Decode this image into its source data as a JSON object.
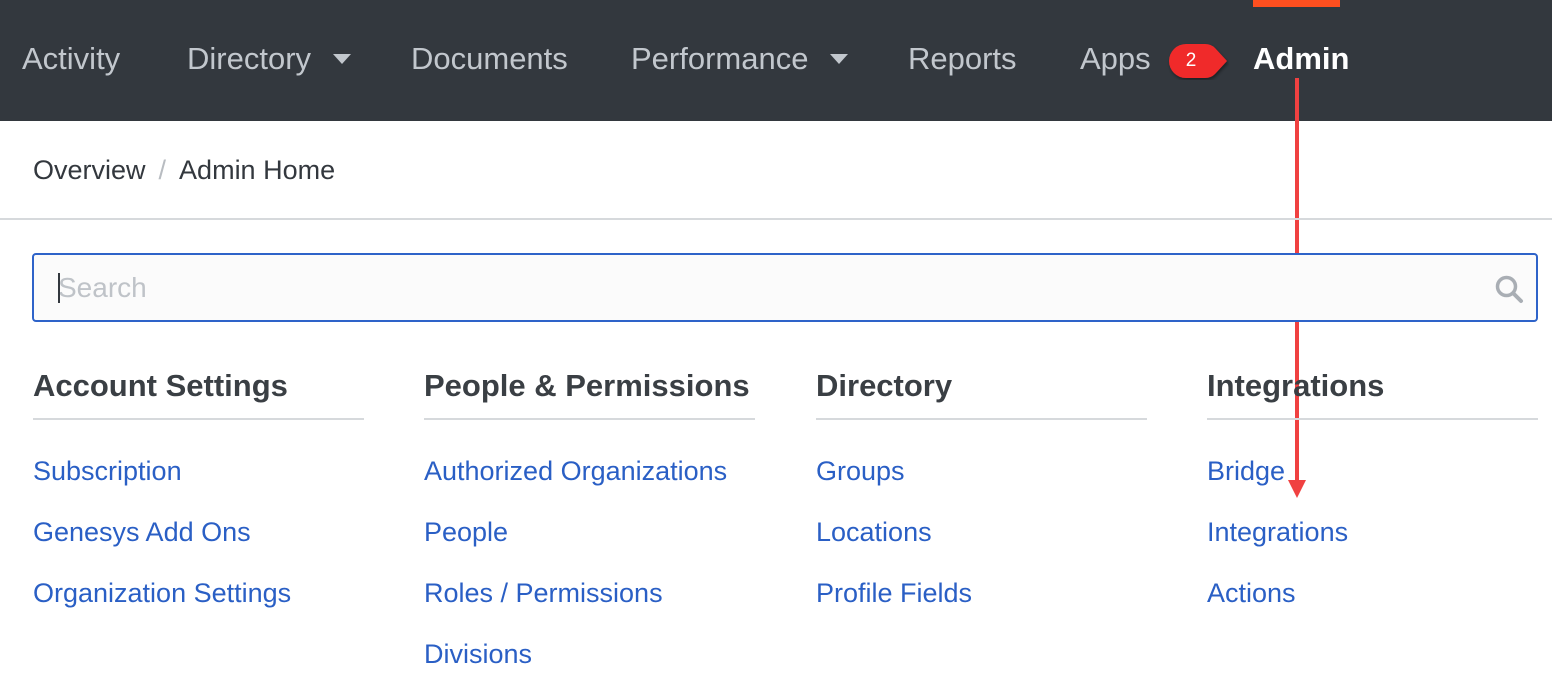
{
  "nav": {
    "items": [
      {
        "label": "Activity",
        "dropdown": false
      },
      {
        "label": "Directory",
        "dropdown": true
      },
      {
        "label": "Documents",
        "dropdown": false
      },
      {
        "label": "Performance",
        "dropdown": true
      },
      {
        "label": "Reports",
        "dropdown": false
      },
      {
        "label": "Apps",
        "dropdown": false
      }
    ],
    "active_label": "Admin",
    "step_badge": "2"
  },
  "breadcrumb": {
    "items": [
      "Overview",
      "Admin Home"
    ],
    "separator": "/"
  },
  "search": {
    "placeholder": "Search",
    "value": "",
    "icon": "search-icon"
  },
  "sections": [
    {
      "title": "Account Settings",
      "links": [
        "Subscription",
        "Genesys Add Ons",
        "Organization Settings"
      ]
    },
    {
      "title": "People & Permissions",
      "links": [
        "Authorized Organizations",
        "People",
        "Roles / Permissions",
        "Divisions"
      ]
    },
    {
      "title": "Directory",
      "links": [
        "Groups",
        "Locations",
        "Profile Fields"
      ]
    },
    {
      "title": "Integrations",
      "links": [
        "Bridge",
        "Integrations",
        "Actions"
      ]
    }
  ],
  "colors": {
    "nav_background": "#33383e",
    "active_indicator": "#ff4f1f",
    "link": "#2a5fc5",
    "annotation": "#f04141",
    "search_border": "#2e63c9"
  }
}
